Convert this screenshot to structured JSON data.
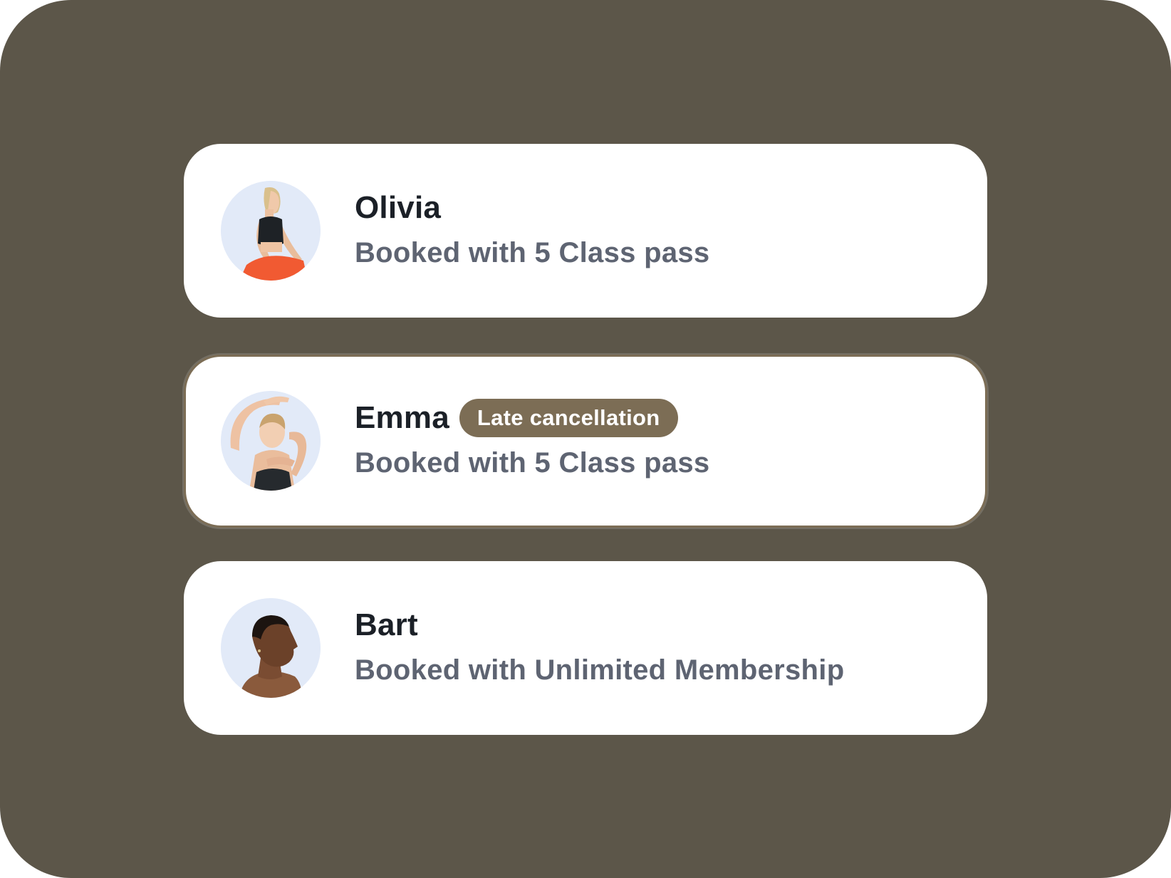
{
  "colors": {
    "background": "#5c5649",
    "card": "#ffffff",
    "badge": "#7c6d55",
    "name_text": "#1b2027",
    "subtitle_text": "#5e6472",
    "avatar_bg": "#e2eaf8"
  },
  "bookings": [
    {
      "name": "Olivia",
      "badge": "",
      "subtitle": "Booked with 5 Class pass",
      "avatar_icon": "avatar-photo-olivia"
    },
    {
      "name": "Emma",
      "badge": "Late cancellation",
      "subtitle": "Booked with 5 Class pass",
      "avatar_icon": "avatar-photo-emma"
    },
    {
      "name": "Bart",
      "badge": "",
      "subtitle": "Booked with Unlimited Membership",
      "avatar_icon": "avatar-photo-bart"
    }
  ]
}
